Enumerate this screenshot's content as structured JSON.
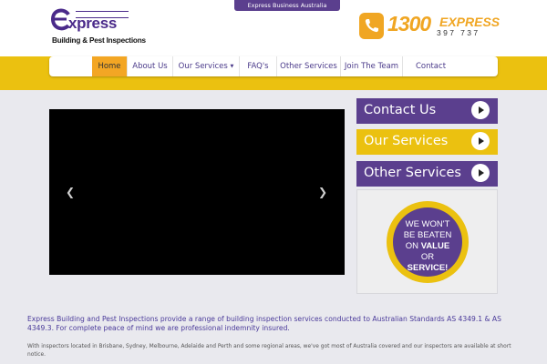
{
  "header": {
    "network_link": "Express Business Australia Network",
    "logo": {
      "word": "xpress",
      "tagline": "Building & Pest Inspections"
    },
    "phone": {
      "number": "1300",
      "word": "EXPRESS",
      "digits": "397 737"
    }
  },
  "nav": {
    "items": [
      {
        "label": "Home",
        "active": true
      },
      {
        "label": "About Us"
      },
      {
        "label": "Our Services",
        "has_dropdown": true
      },
      {
        "label": "FAQ's"
      },
      {
        "label": "Other Services"
      },
      {
        "label": "Join The Team"
      },
      {
        "label": "Contact"
      }
    ]
  },
  "carousel": {
    "prev_glyph": "❮",
    "next_glyph": "❯"
  },
  "sidebar": {
    "buttons": [
      {
        "label": "Contact Us",
        "color": "#5b3f8e"
      },
      {
        "label": "Our Services",
        "color": "#ebc110"
      },
      {
        "label": "Other Services",
        "color": "#5b3f8e"
      }
    ],
    "badge": {
      "line1": "WE WON'T",
      "line2": "BE BEATEN",
      "line3_prefix": "ON ",
      "line3_bold": "VALUE",
      "line4": "OR",
      "line5": "SERVICE!"
    }
  },
  "content": {
    "intro": "Express Building and Pest Inspections provide a range of building inspection services conducted to Australian Standards AS 4349.1 & AS 4349.3. For complete peace of mind we are professional indemnity insured.",
    "detail": "With inspectors located in Brisbane, Sydney, Melbourne, Adelaide and Perth and some regional areas, we've got most of Australia covered and our inspectors are available at short notice."
  },
  "colors": {
    "brand_purple": "#5b3f8e",
    "brand_yellow": "#ebc110",
    "accent_orange": "#f3a624"
  }
}
